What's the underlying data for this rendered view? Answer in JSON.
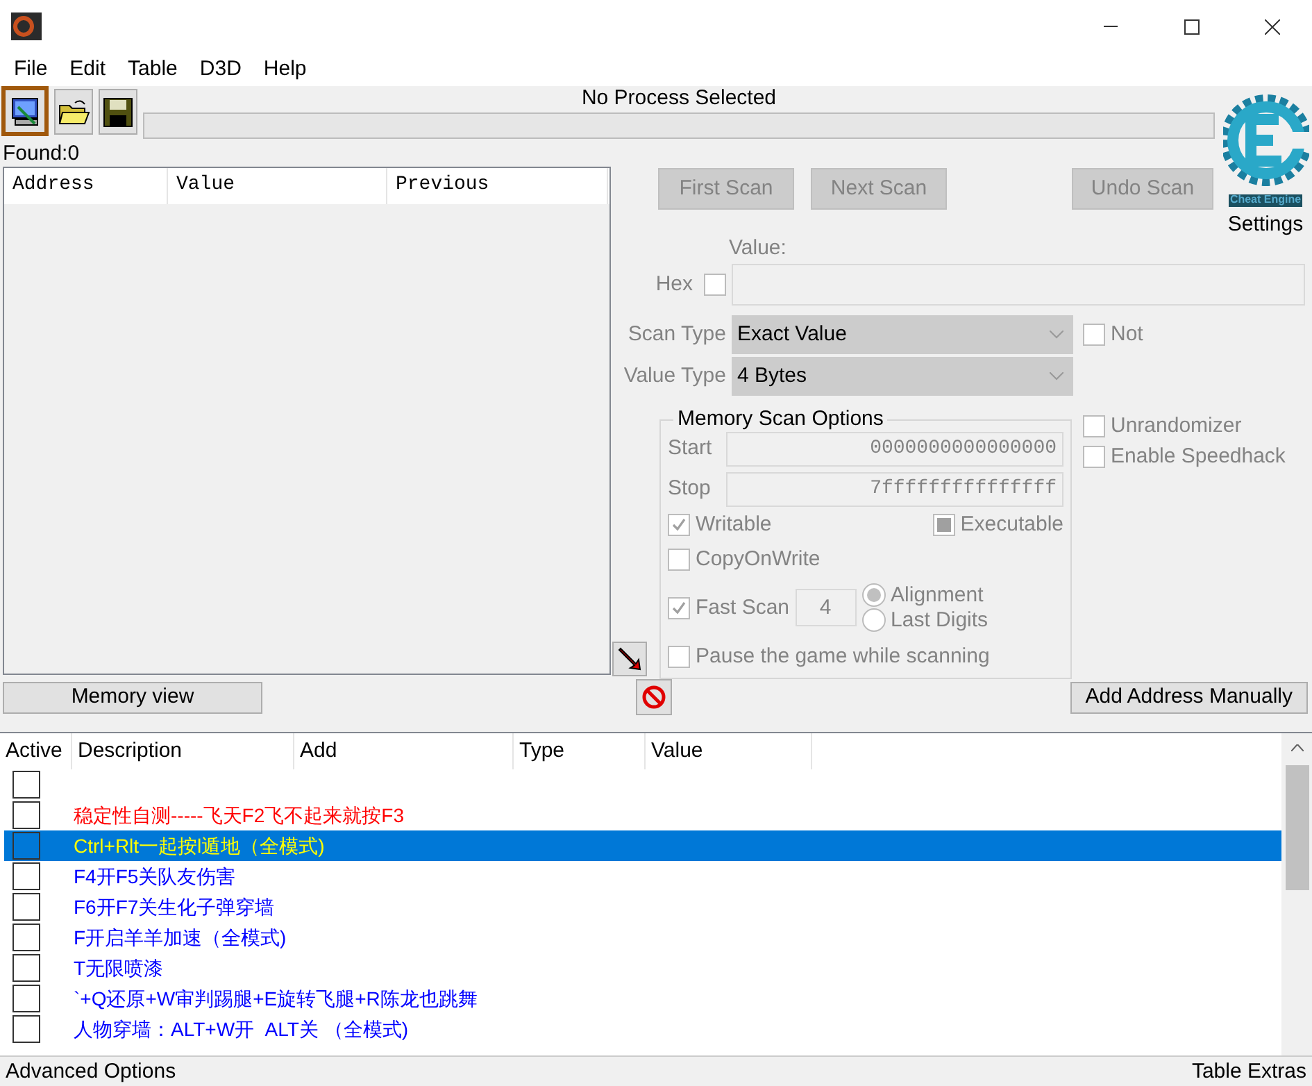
{
  "menu": [
    "File",
    "Edit",
    "Table",
    "D3D",
    "Help"
  ],
  "toolbar": [
    {
      "kind": "process",
      "selected": true
    },
    {
      "kind": "open",
      "selected": false
    },
    {
      "kind": "save",
      "selected": false
    }
  ],
  "process_label": "No Process Selected",
  "progress": {
    "level": 0
  },
  "found": "Found:0",
  "results": {
    "columns": [
      "Address",
      "Value",
      "Previous"
    ]
  },
  "scan_buttons": [
    {
      "label": "First Scan",
      "disabled": true
    },
    {
      "label": "Next Scan",
      "disabled": true
    },
    {
      "label": "Undo Scan",
      "disabled": true
    }
  ],
  "logo": {
    "text": "Cheat Engine"
  },
  "settings": "Settings",
  "scan": {
    "disabled": true,
    "value_label": "Value:",
    "hex": {
      "label": "Hex",
      "checked": false
    },
    "scan_type": {
      "label": "Scan Type",
      "value": "Exact Value"
    },
    "value_type": {
      "label": "Value Type",
      "value": "4 Bytes"
    },
    "not": {
      "label": "Not",
      "checked": false
    },
    "options": {
      "title": "Memory Scan Options",
      "start": {
        "label": "Start",
        "value": "0000000000000000"
      },
      "stop": {
        "label": "Stop",
        "value": "7fffffffffffffff"
      },
      "writable": {
        "label": "Writable",
        "checked": true
      },
      "executable": {
        "label": "Executable",
        "checked": false,
        "partial": true
      },
      "copy_on_write": {
        "label": "CopyOnWrite",
        "checked": false
      },
      "fast_scan": {
        "label": "Fast Scan",
        "checked": true,
        "value": "4"
      },
      "alignment": [
        {
          "label": "Alignment",
          "selected": true
        },
        {
          "label": "Last Digits",
          "selected": false
        }
      ],
      "pause": {
        "label": "Pause the game while scanning",
        "checked": false
      }
    },
    "unrandomizer": {
      "label": "Unrandomizer",
      "checked": false
    },
    "speedhack": {
      "label": "Enable Speedhack",
      "checked": false
    }
  },
  "memory_view": "Memory view",
  "add_address": "Add Address Manually",
  "cheat_table": {
    "columns": [
      "Active",
      "Description",
      "Add",
      "Type",
      "Value"
    ],
    "rows": [
      {
        "active": false,
        "selected": false
      },
      {
        "active": false,
        "selected": false,
        "color": "#ff0000",
        "description": "稳定性自测-----飞天F2飞不起来就按F3"
      },
      {
        "active": false,
        "selected": true,
        "color": "#ffff00",
        "description": "Ctrl+Rlt一起按l遁地（全模式)"
      },
      {
        "active": false,
        "selected": false,
        "color": "#0000ff",
        "description": "F4开F5关队友伤害"
      },
      {
        "active": false,
        "selected": false,
        "color": "#0000ff",
        "description": "F6开F7关生化子弹穿墙"
      },
      {
        "active": false,
        "selected": false,
        "color": "#0000ff",
        "description": "F开启羊羊加速（全模式)"
      },
      {
        "active": false,
        "selected": false,
        "color": "#0000ff",
        "description": "T无限喷漆"
      },
      {
        "active": false,
        "selected": false,
        "color": "#0000ff",
        "description": "`+Q还原+W审判踢腿+E旋转飞腿+R陈龙也跳舞"
      },
      {
        "active": false,
        "selected": false,
        "color": "#0000ff",
        "description": "人物穿墙：ALT+W开  ALT关 （全模式)"
      }
    ]
  },
  "status_bar": {
    "left": "Advanced Options",
    "right": "Table Extras"
  }
}
